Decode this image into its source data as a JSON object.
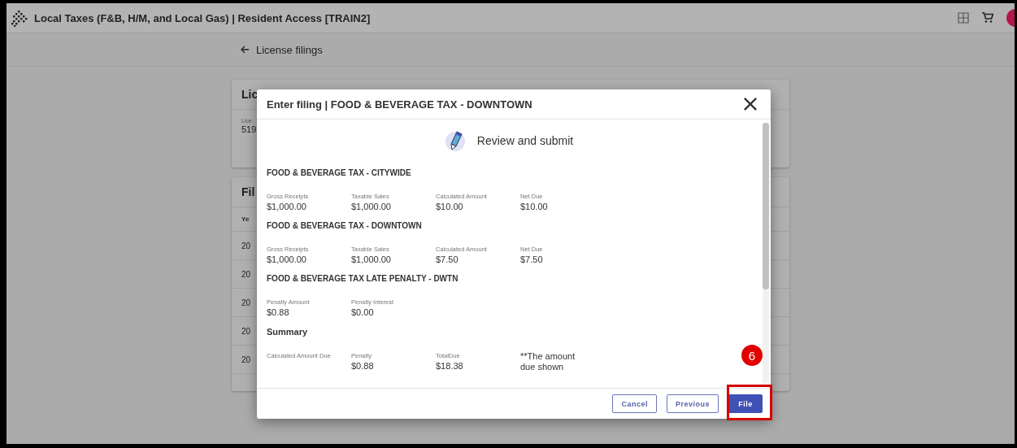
{
  "app_bar": {
    "title": "Local Taxes (F&B, H/M, and Local Gas) | Resident Access [TRAIN2]"
  },
  "back_link": {
    "label": "License filings"
  },
  "background": {
    "license_card": {
      "title": "Lic",
      "field_label": "Lice",
      "field_value": "519"
    },
    "filings_card": {
      "title": "Fil",
      "column_1": "Ye",
      "rows": [
        "20",
        "20",
        "20",
        "20",
        "20"
      ]
    }
  },
  "dialog": {
    "title": "Enter filing | FOOD & BEVERAGE TAX - DOWNTOWN",
    "step_title": "Review and submit",
    "sections": [
      {
        "heading": "FOOD & BEVERAGE TAX - CITYWIDE",
        "fields": [
          {
            "label": "Gross Receipts",
            "value": "$1,000.00"
          },
          {
            "label": "Taxable Sales",
            "value": "$1,000.00"
          },
          {
            "label": "Calculated Amount",
            "value": "$10.00"
          },
          {
            "label": "Net Due",
            "value": "$10.00"
          }
        ]
      },
      {
        "heading": "FOOD & BEVERAGE TAX - DOWNTOWN",
        "fields": [
          {
            "label": "Gross Receipts",
            "value": "$1,000.00"
          },
          {
            "label": "Taxable Sales",
            "value": "$1,000.00"
          },
          {
            "label": "Calculated Amount",
            "value": "$7.50"
          },
          {
            "label": "Net Due",
            "value": "$7.50"
          }
        ]
      },
      {
        "heading": "FOOD & BEVERAGE TAX LATE PENALTY - DWTN",
        "fields": [
          {
            "label": "Penalty Amount",
            "value": "$0.88"
          },
          {
            "label": "Penalty Interest",
            "value": "$0.00"
          }
        ]
      }
    ],
    "summary": {
      "heading": "Summary",
      "fields": [
        {
          "label": "Calculated Amount Due"
        },
        {
          "label": "Penalty",
          "value": "$0.88"
        },
        {
          "label": "TotalDue",
          "value": "$18.38"
        }
      ],
      "note": "**The amount due shown"
    },
    "buttons": [
      {
        "label": "Cancel",
        "kind": "outlined"
      },
      {
        "label": "Previous",
        "kind": "outlined"
      },
      {
        "label": "File",
        "kind": "primary"
      }
    ]
  },
  "annotation": {
    "step_number": "6"
  }
}
